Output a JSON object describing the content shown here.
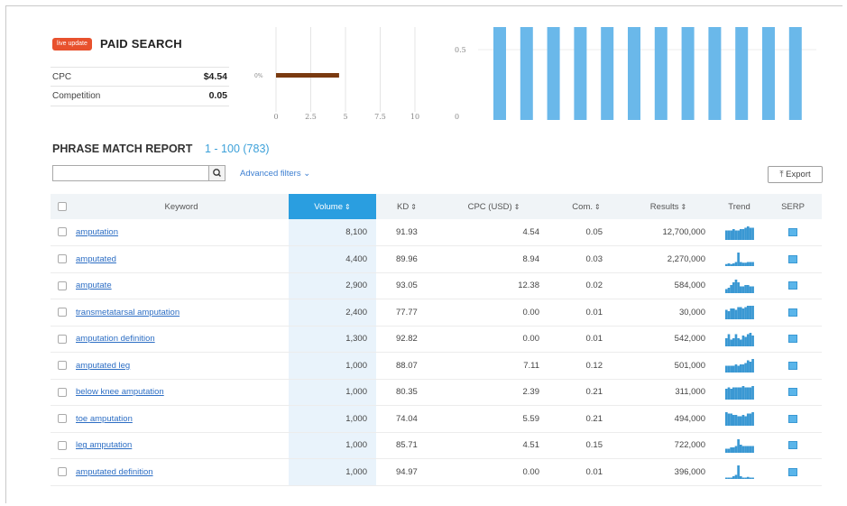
{
  "paid_search": {
    "badge": "live update",
    "title": "PAID SEARCH",
    "stats": [
      {
        "label": "CPC",
        "value": "$4.54"
      },
      {
        "label": "Competition",
        "value": "0.05"
      }
    ]
  },
  "cpc_chart": {
    "row_label": "0%",
    "value": 4.54,
    "xlim": [
      0,
      10
    ],
    "ticks": [
      "0",
      "2.5",
      "5",
      "7.5",
      "10"
    ],
    "bar_color": "#7a3a10"
  },
  "volume_chart": {
    "y_ticks": [
      "0.5",
      "0"
    ],
    "bar_count": 12,
    "bar_color": "#6ab8ea"
  },
  "phrase_match": {
    "title": "PHRASE MATCH REPORT",
    "range": "1 - 100 (783)",
    "search_placeholder": "",
    "advanced_filters": "Advanced filters ⌄",
    "export": "⤒ Export"
  },
  "table": {
    "headers": {
      "keyword": "Keyword",
      "volume": "Volume",
      "kd": "KD",
      "cpc": "CPC (USD)",
      "com": "Com.",
      "results": "Results",
      "trend": "Trend",
      "serp": "SERP"
    },
    "rows": [
      {
        "keyword": "amputation",
        "volume": "8,100",
        "kd": "91.93",
        "cpc": "4.54",
        "com": "0.05",
        "results": "12,700,000",
        "trend": [
          0.7,
          0.7,
          0.7,
          0.8,
          0.7,
          0.7,
          0.8,
          0.8,
          0.9,
          1.0,
          0.9,
          0.9
        ]
      },
      {
        "keyword": "amputated",
        "volume": "4,400",
        "kd": "89.96",
        "cpc": "8.94",
        "com": "0.03",
        "results": "2,270,000",
        "trend": [
          0.15,
          0.2,
          0.15,
          0.2,
          0.3,
          1.0,
          0.3,
          0.25,
          0.25,
          0.3,
          0.3,
          0.3
        ]
      },
      {
        "keyword": "amputate",
        "volume": "2,900",
        "kd": "93.05",
        "cpc": "12.38",
        "com": "0.02",
        "results": "584,000",
        "trend": [
          0.3,
          0.4,
          0.6,
          0.8,
          1.0,
          0.8,
          0.5,
          0.5,
          0.6,
          0.6,
          0.5,
          0.5
        ]
      },
      {
        "keyword": "transmetatarsal amputation",
        "volume": "2,400",
        "kd": "77.77",
        "cpc": "0.00",
        "com": "0.01",
        "results": "30,000",
        "trend": [
          0.7,
          0.6,
          0.8,
          0.8,
          0.7,
          0.9,
          0.9,
          0.8,
          0.9,
          1.0,
          1.0,
          1.0
        ]
      },
      {
        "keyword": "amputation definition",
        "volume": "1,300",
        "kd": "92.82",
        "cpc": "0.00",
        "com": "0.01",
        "results": "542,000",
        "trend": [
          0.6,
          0.9,
          0.5,
          0.6,
          0.9,
          0.6,
          0.5,
          0.8,
          0.7,
          0.9,
          1.0,
          0.8
        ]
      },
      {
        "keyword": "amputated leg",
        "volume": "1,000",
        "kd": "88.07",
        "cpc": "7.11",
        "com": "0.12",
        "results": "501,000",
        "trend": [
          0.5,
          0.5,
          0.5,
          0.5,
          0.6,
          0.5,
          0.6,
          0.6,
          0.7,
          0.9,
          0.8,
          1.0
        ]
      },
      {
        "keyword": "below knee amputation",
        "volume": "1,000",
        "kd": "80.35",
        "cpc": "2.39",
        "com": "0.21",
        "results": "311,000",
        "trend": [
          0.8,
          0.9,
          0.8,
          0.9,
          0.9,
          0.9,
          0.9,
          1.0,
          0.9,
          0.9,
          0.9,
          1.0
        ]
      },
      {
        "keyword": "toe amputation",
        "volume": "1,000",
        "kd": "74.04",
        "cpc": "5.59",
        "com": "0.21",
        "results": "494,000",
        "trend": [
          1.0,
          0.9,
          0.9,
          0.8,
          0.8,
          0.7,
          0.7,
          0.8,
          0.7,
          0.9,
          0.9,
          1.0
        ]
      },
      {
        "keyword": "leg amputation",
        "volume": "1,000",
        "kd": "85.71",
        "cpc": "4.51",
        "com": "0.15",
        "results": "722,000",
        "trend": [
          0.3,
          0.3,
          0.4,
          0.4,
          0.5,
          1.0,
          0.6,
          0.5,
          0.5,
          0.5,
          0.5,
          0.5
        ]
      },
      {
        "keyword": "amputated definition",
        "volume": "1,000",
        "kd": "94.97",
        "cpc": "0.00",
        "com": "0.01",
        "results": "396,000",
        "trend": [
          0.1,
          0.1,
          0.1,
          0.2,
          0.3,
          1.0,
          0.2,
          0.1,
          0.1,
          0.15,
          0.1,
          0.1
        ]
      }
    ]
  },
  "colors": {
    "accent": "#2a9ee0",
    "badge": "#e8512d",
    "link": "#2d6ec4",
    "trend": "#3a98d3"
  }
}
